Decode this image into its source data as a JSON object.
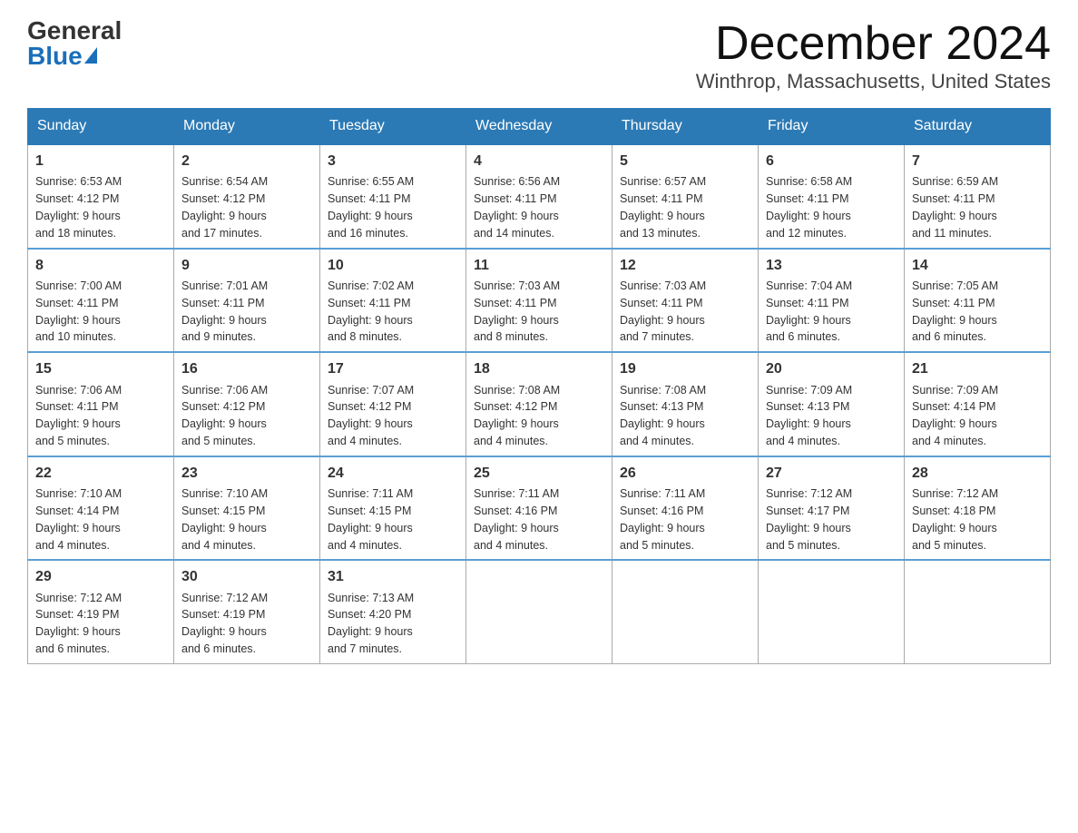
{
  "header": {
    "logo_general": "General",
    "logo_blue": "Blue",
    "month_title": "December 2024",
    "location": "Winthrop, Massachusetts, United States"
  },
  "days_of_week": [
    "Sunday",
    "Monday",
    "Tuesday",
    "Wednesday",
    "Thursday",
    "Friday",
    "Saturday"
  ],
  "weeks": [
    [
      {
        "day": "1",
        "sunrise": "6:53 AM",
        "sunset": "4:12 PM",
        "daylight": "9 hours and 18 minutes."
      },
      {
        "day": "2",
        "sunrise": "6:54 AM",
        "sunset": "4:12 PM",
        "daylight": "9 hours and 17 minutes."
      },
      {
        "day": "3",
        "sunrise": "6:55 AM",
        "sunset": "4:11 PM",
        "daylight": "9 hours and 16 minutes."
      },
      {
        "day": "4",
        "sunrise": "6:56 AM",
        "sunset": "4:11 PM",
        "daylight": "9 hours and 14 minutes."
      },
      {
        "day": "5",
        "sunrise": "6:57 AM",
        "sunset": "4:11 PM",
        "daylight": "9 hours and 13 minutes."
      },
      {
        "day": "6",
        "sunrise": "6:58 AM",
        "sunset": "4:11 PM",
        "daylight": "9 hours and 12 minutes."
      },
      {
        "day": "7",
        "sunrise": "6:59 AM",
        "sunset": "4:11 PM",
        "daylight": "9 hours and 11 minutes."
      }
    ],
    [
      {
        "day": "8",
        "sunrise": "7:00 AM",
        "sunset": "4:11 PM",
        "daylight": "9 hours and 10 minutes."
      },
      {
        "day": "9",
        "sunrise": "7:01 AM",
        "sunset": "4:11 PM",
        "daylight": "9 hours and 9 minutes."
      },
      {
        "day": "10",
        "sunrise": "7:02 AM",
        "sunset": "4:11 PM",
        "daylight": "9 hours and 8 minutes."
      },
      {
        "day": "11",
        "sunrise": "7:03 AM",
        "sunset": "4:11 PM",
        "daylight": "9 hours and 8 minutes."
      },
      {
        "day": "12",
        "sunrise": "7:03 AM",
        "sunset": "4:11 PM",
        "daylight": "9 hours and 7 minutes."
      },
      {
        "day": "13",
        "sunrise": "7:04 AM",
        "sunset": "4:11 PM",
        "daylight": "9 hours and 6 minutes."
      },
      {
        "day": "14",
        "sunrise": "7:05 AM",
        "sunset": "4:11 PM",
        "daylight": "9 hours and 6 minutes."
      }
    ],
    [
      {
        "day": "15",
        "sunrise": "7:06 AM",
        "sunset": "4:11 PM",
        "daylight": "9 hours and 5 minutes."
      },
      {
        "day": "16",
        "sunrise": "7:06 AM",
        "sunset": "4:12 PM",
        "daylight": "9 hours and 5 minutes."
      },
      {
        "day": "17",
        "sunrise": "7:07 AM",
        "sunset": "4:12 PM",
        "daylight": "9 hours and 4 minutes."
      },
      {
        "day": "18",
        "sunrise": "7:08 AM",
        "sunset": "4:12 PM",
        "daylight": "9 hours and 4 minutes."
      },
      {
        "day": "19",
        "sunrise": "7:08 AM",
        "sunset": "4:13 PM",
        "daylight": "9 hours and 4 minutes."
      },
      {
        "day": "20",
        "sunrise": "7:09 AM",
        "sunset": "4:13 PM",
        "daylight": "9 hours and 4 minutes."
      },
      {
        "day": "21",
        "sunrise": "7:09 AM",
        "sunset": "4:14 PM",
        "daylight": "9 hours and 4 minutes."
      }
    ],
    [
      {
        "day": "22",
        "sunrise": "7:10 AM",
        "sunset": "4:14 PM",
        "daylight": "9 hours and 4 minutes."
      },
      {
        "day": "23",
        "sunrise": "7:10 AM",
        "sunset": "4:15 PM",
        "daylight": "9 hours and 4 minutes."
      },
      {
        "day": "24",
        "sunrise": "7:11 AM",
        "sunset": "4:15 PM",
        "daylight": "9 hours and 4 minutes."
      },
      {
        "day": "25",
        "sunrise": "7:11 AM",
        "sunset": "4:16 PM",
        "daylight": "9 hours and 4 minutes."
      },
      {
        "day": "26",
        "sunrise": "7:11 AM",
        "sunset": "4:16 PM",
        "daylight": "9 hours and 5 minutes."
      },
      {
        "day": "27",
        "sunrise": "7:12 AM",
        "sunset": "4:17 PM",
        "daylight": "9 hours and 5 minutes."
      },
      {
        "day": "28",
        "sunrise": "7:12 AM",
        "sunset": "4:18 PM",
        "daylight": "9 hours and 5 minutes."
      }
    ],
    [
      {
        "day": "29",
        "sunrise": "7:12 AM",
        "sunset": "4:19 PM",
        "daylight": "9 hours and 6 minutes."
      },
      {
        "day": "30",
        "sunrise": "7:12 AM",
        "sunset": "4:19 PM",
        "daylight": "9 hours and 6 minutes."
      },
      {
        "day": "31",
        "sunrise": "7:13 AM",
        "sunset": "4:20 PM",
        "daylight": "9 hours and 7 minutes."
      },
      null,
      null,
      null,
      null
    ]
  ],
  "labels": {
    "sunrise": "Sunrise:",
    "sunset": "Sunset:",
    "daylight": "Daylight:"
  }
}
